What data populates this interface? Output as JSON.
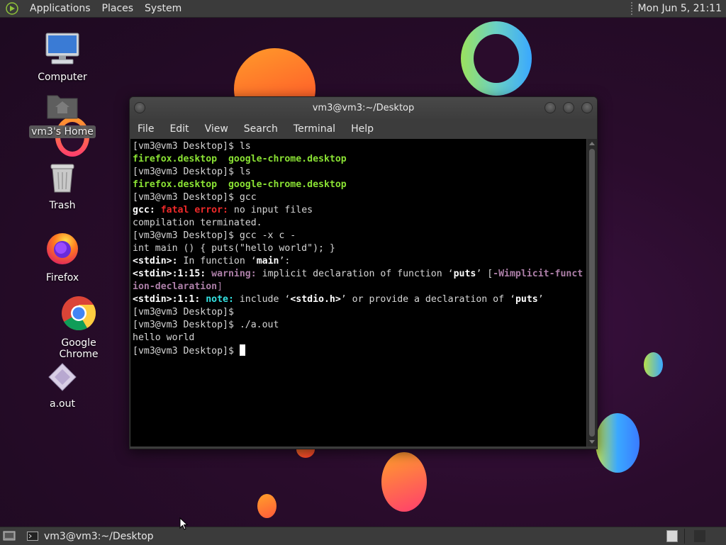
{
  "top_panel": {
    "menus": [
      "Applications",
      "Places",
      "System"
    ],
    "clock": "Mon Jun  5, 21:11"
  },
  "desktop_icons": [
    {
      "label": "Computer",
      "icon": "computer-icon"
    },
    {
      "label": "vm3's Home",
      "icon": "home-folder-icon"
    },
    {
      "label": "Trash",
      "icon": "trash-icon"
    },
    {
      "label": "Firefox",
      "icon": "firefox-icon"
    },
    {
      "label": "Google Chrome",
      "icon": "chrome-icon"
    },
    {
      "label": "a.out",
      "icon": "executable-icon"
    }
  ],
  "window": {
    "title": "vm3@vm3:~/Desktop",
    "menu": [
      "File",
      "Edit",
      "View",
      "Search",
      "Terminal",
      "Help"
    ]
  },
  "terminal": {
    "lines": [
      [
        {
          "t": "[vm3@vm3 Desktop]$ ls"
        }
      ],
      [
        {
          "t": "firefox.desktop  google-chrome.desktop",
          "c": "g"
        }
      ],
      [
        {
          "t": "[vm3@vm3 Desktop]$ ls"
        }
      ],
      [
        {
          "t": "firefox.desktop  google-chrome.desktop",
          "c": "g"
        }
      ],
      [
        {
          "t": "[vm3@vm3 Desktop]$ gcc"
        }
      ],
      [
        {
          "t": "gcc: ",
          "c": "b"
        },
        {
          "t": "fatal error: ",
          "c": "r"
        },
        {
          "t": "no input files"
        }
      ],
      [
        {
          "t": "compilation terminated."
        }
      ],
      [
        {
          "t": "[vm3@vm3 Desktop]$ gcc -x c -"
        }
      ],
      [
        {
          "t": "int main () { puts(\"hello world\"); }"
        }
      ],
      [
        {
          "t": "<stdin>:",
          "c": "b"
        },
        {
          "t": " In function ‘"
        },
        {
          "t": "main",
          "c": "b"
        },
        {
          "t": "’:"
        }
      ],
      [
        {
          "t": "<stdin>:1:15: ",
          "c": "b"
        },
        {
          "t": "warning: ",
          "c": "m"
        },
        {
          "t": "implicit declaration of function ‘"
        },
        {
          "t": "puts",
          "c": "b"
        },
        {
          "t": "’ ["
        },
        {
          "t": "-Wimplicit-funct",
          "c": "m"
        }
      ],
      [
        {
          "t": "ion-declaration",
          "c": "m"
        },
        {
          "t": "]",
          "c": "mn"
        }
      ],
      [
        {
          "t": "<stdin>:1:1: ",
          "c": "b"
        },
        {
          "t": "note: ",
          "c": "c"
        },
        {
          "t": "include ‘"
        },
        {
          "t": "<stdio.h>",
          "c": "b"
        },
        {
          "t": "’ or provide a declaration of ‘"
        },
        {
          "t": "puts",
          "c": "b"
        },
        {
          "t": "’"
        }
      ],
      [
        {
          "t": "[vm3@vm3 Desktop]$"
        }
      ],
      [
        {
          "t": "[vm3@vm3 Desktop]$ ./a.out"
        }
      ],
      [
        {
          "t": "hello world"
        }
      ],
      [
        {
          "t": "[vm3@vm3 Desktop]$ "
        },
        {
          "cursor": true
        }
      ]
    ]
  },
  "bottom_panel": {
    "task_label": "vm3@vm3:~/Desktop"
  }
}
